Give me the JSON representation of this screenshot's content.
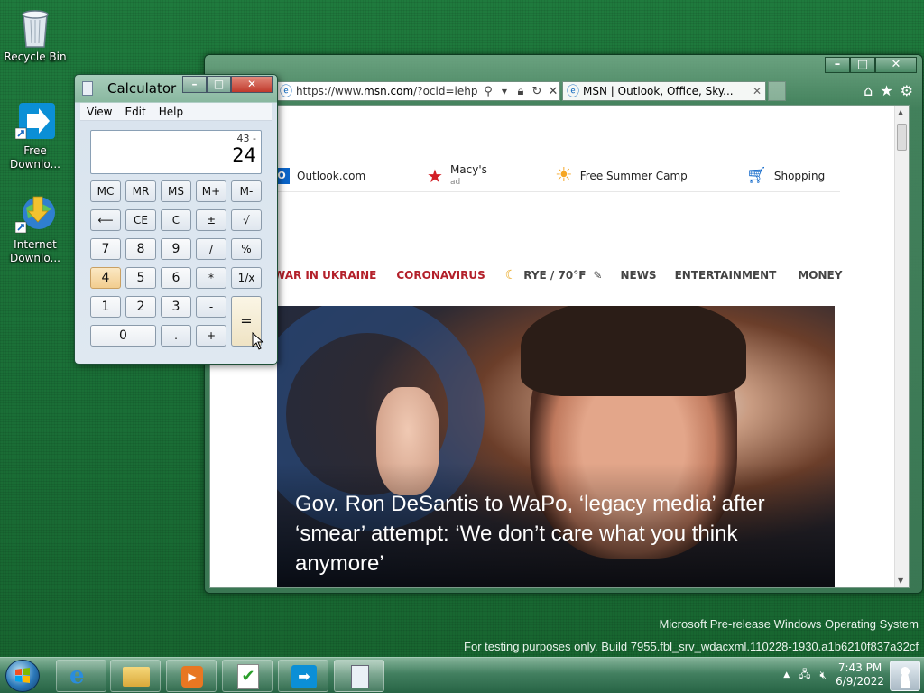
{
  "desktop": {
    "icons": [
      {
        "label": "Recycle Bin"
      },
      {
        "label": "Free Downlo..."
      },
      {
        "label": "Internet Downlo..."
      }
    ],
    "watermark_line1": "Microsoft Pre-release Windows Operating System",
    "watermark_line2": "For testing purposes only. Build 7955.fbl_srv_wdacxml.110228-1930.a1b6210f837a32cf"
  },
  "browser": {
    "address_prefix": "https://www.",
    "address_domain": "msn.com",
    "address_suffix": "/?ocid=iehp",
    "tab_title": "MSN | Outlook, Office, Sky...",
    "quicklinks": [
      {
        "label": "Outlook.com"
      },
      {
        "label": "Macy's",
        "sub": "ad"
      },
      {
        "label": "Free Summer Camp"
      },
      {
        "label": "Shopping"
      }
    ],
    "nav": {
      "war": "WAR IN UKRAINE",
      "corona": "CORONAVIRUS",
      "weather": "RYE / 70°F",
      "news": "NEWS",
      "entertainment": "ENTERTAINMENT",
      "money": "MONEY"
    },
    "headline": "Gov. Ron DeSantis to WaPo, ‘legacy media’ after ‘smear’ attempt: ‘We don’t care what you think anymore’"
  },
  "calculator": {
    "title": "Calculator",
    "menu": [
      "View",
      "Edit",
      "Help"
    ],
    "memo": "43 -",
    "value": "24",
    "keys": {
      "mc": "MC",
      "mr": "MR",
      "ms": "MS",
      "mplus": "M+",
      "mminus": "M-",
      "back": "⟵",
      "ce": "CE",
      "c": "C",
      "pm": "±",
      "sqrt": "√",
      "k7": "7",
      "k8": "8",
      "k9": "9",
      "div": "/",
      "pct": "%",
      "k4": "4",
      "k5": "5",
      "k6": "6",
      "mul": "*",
      "inv": "1/x",
      "k1": "1",
      "k2": "2",
      "k3": "3",
      "sub": "-",
      "eq": "=",
      "k0": "0",
      "dot": ".",
      "add": "+"
    }
  },
  "taskbar": {
    "time": "7:43 PM",
    "date": "6/9/2022"
  }
}
